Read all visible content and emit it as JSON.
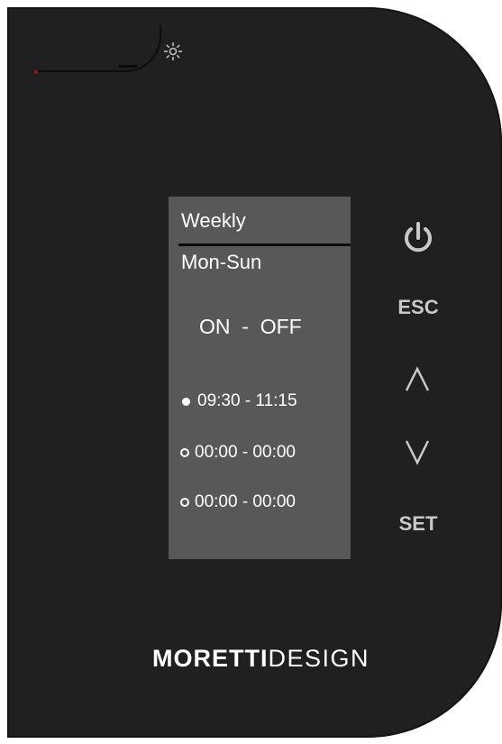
{
  "device": {
    "colors": {
      "body": "#202020",
      "screen": "#585858",
      "text": "#ffffff",
      "button": "#c9c9c9"
    }
  },
  "top": {
    "icon": "sun-icon"
  },
  "screen": {
    "title": "Weekly",
    "days": "Mon-Sun",
    "onoff": "ON  -  OFF",
    "slots": [
      {
        "marker": "filled",
        "time": "09:30 - 11:15"
      },
      {
        "marker": "empty",
        "time": "00:00 - 00:00"
      },
      {
        "marker": "empty",
        "time": "00:00 - 00:00"
      }
    ]
  },
  "buttons": {
    "power_icon": "power-icon",
    "esc": "ESC",
    "up_icon": "chevron-up-icon",
    "down_icon": "chevron-down-icon",
    "set": "SET"
  },
  "brand": {
    "bold": "MORETTI",
    "light": "DESIGN"
  }
}
